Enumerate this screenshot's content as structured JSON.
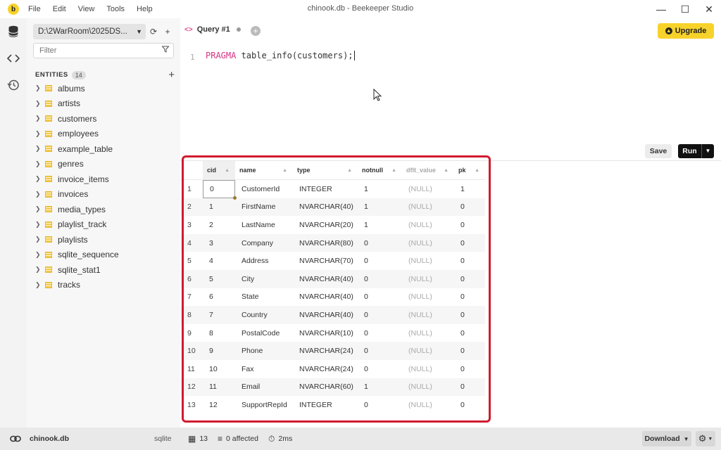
{
  "window": {
    "title": "chinook.db - Beekeeper Studio",
    "menu": [
      "File",
      "Edit",
      "View",
      "Tools",
      "Help"
    ],
    "logo_letter": "b"
  },
  "sidebar": {
    "connection": "D:\\2WarRoom\\2025DS...",
    "filter_placeholder": "Filter",
    "entities_title": "ENTITIES",
    "entities_count": "14",
    "entities": [
      "albums",
      "artists",
      "customers",
      "employees",
      "example_table",
      "genres",
      "invoice_items",
      "invoices",
      "media_types",
      "playlist_track",
      "playlists",
      "sqlite_sequence",
      "sqlite_stat1",
      "tracks"
    ]
  },
  "tabs": {
    "active_label": "Query #1",
    "upgrade_label": "Upgrade"
  },
  "editor": {
    "line_number": "1",
    "keyword": "PRAGMA",
    "rest": " table_info(customers);"
  },
  "toolbar": {
    "save_label": "Save",
    "run_label": "Run"
  },
  "results": {
    "columns": [
      "cid",
      "name",
      "type",
      "notnull",
      "dflt_value",
      "pk"
    ],
    "rows": [
      [
        "1",
        "0",
        "CustomerId",
        "INTEGER",
        "1",
        "(NULL)",
        "1"
      ],
      [
        "2",
        "1",
        "FirstName",
        "NVARCHAR(40)",
        "1",
        "(NULL)",
        "0"
      ],
      [
        "3",
        "2",
        "LastName",
        "NVARCHAR(20)",
        "1",
        "(NULL)",
        "0"
      ],
      [
        "4",
        "3",
        "Company",
        "NVARCHAR(80)",
        "0",
        "(NULL)",
        "0"
      ],
      [
        "5",
        "4",
        "Address",
        "NVARCHAR(70)",
        "0",
        "(NULL)",
        "0"
      ],
      [
        "6",
        "5",
        "City",
        "NVARCHAR(40)",
        "0",
        "(NULL)",
        "0"
      ],
      [
        "7",
        "6",
        "State",
        "NVARCHAR(40)",
        "0",
        "(NULL)",
        "0"
      ],
      [
        "8",
        "7",
        "Country",
        "NVARCHAR(40)",
        "0",
        "(NULL)",
        "0"
      ],
      [
        "9",
        "8",
        "PostalCode",
        "NVARCHAR(10)",
        "0",
        "(NULL)",
        "0"
      ],
      [
        "10",
        "9",
        "Phone",
        "NVARCHAR(24)",
        "0",
        "(NULL)",
        "0"
      ],
      [
        "11",
        "10",
        "Fax",
        "NVARCHAR(24)",
        "0",
        "(NULL)",
        "0"
      ],
      [
        "12",
        "11",
        "Email",
        "NVARCHAR(60)",
        "1",
        "(NULL)",
        "0"
      ],
      [
        "13",
        "12",
        "SupportRepId",
        "INTEGER",
        "0",
        "(NULL)",
        "0"
      ]
    ]
  },
  "status": {
    "db_name": "chinook.db",
    "engine": "sqlite",
    "row_count": "13",
    "affected": "0 affected",
    "duration": "2ms",
    "download_label": "Download"
  },
  "colors": {
    "accent": "#f7d22a",
    "highlight_border": "#d11b2f",
    "keyword": "#d63384"
  }
}
